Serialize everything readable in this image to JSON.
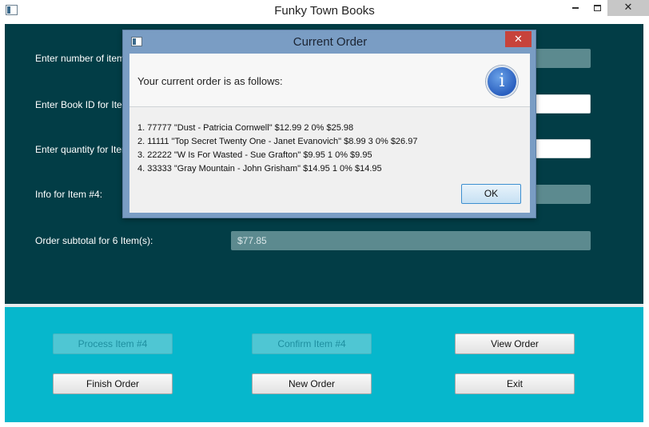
{
  "window": {
    "title": "Funky Town Books",
    "minimize_icon": "minimize-icon",
    "maximize_icon": "maximize-icon",
    "close_glyph": "✕"
  },
  "form": {
    "num_items_label": "Enter number of items in this order:",
    "book_id_label": "Enter Book ID for Item #4:",
    "quantity_label": "Enter quantity for Item #4:",
    "info_label": "Info for Item #4:",
    "subtotal_label": "Order subtotal for 6 Item(s):",
    "subtotal_value": "$77.85"
  },
  "buttons": {
    "process": "Process Item #4",
    "confirm": "Confirm Item #4",
    "view": "View Order",
    "finish": "Finish Order",
    "new": "New Order",
    "exit": "Exit"
  },
  "dialog": {
    "title": "Current Order",
    "close_glyph": "✕",
    "heading": "Your current order is as follows:",
    "info_glyph": "i",
    "lines": [
      "1. 77777 \"Dust - Patricia Cornwell\" $12.99 2 0% $25.98",
      "2. 11111 \"Top Secret Twenty One - Janet Evanovich\" $8.99 3 0% $26.97",
      "3. 22222 \"W Is For Wasted - Sue Grafton\" $9.95 1 0% $9.95",
      "4. 33333 \"Gray Mountain - John Grisham\" $14.95 1 0% $14.95"
    ],
    "ok_label": "OK"
  },
  "colors": {
    "form_bg": "#023d46",
    "button_panel_bg": "#06b7cc",
    "dialog_frame": "#7a9dc4",
    "dialog_close": "#c7433b"
  }
}
